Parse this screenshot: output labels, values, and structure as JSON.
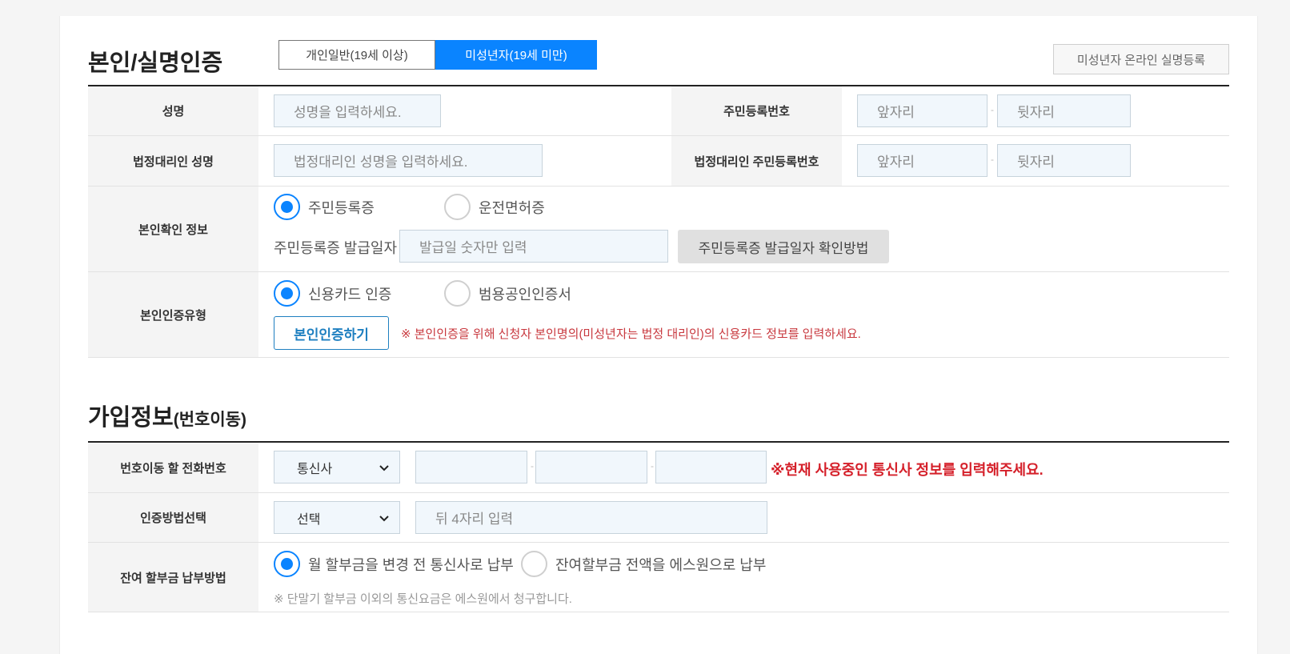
{
  "section1": {
    "title": "본인/실명인증",
    "tabs": [
      {
        "label": "개인일반(19세 이상)",
        "active": false
      },
      {
        "label": "미성년자(19세 미만)",
        "active": true
      }
    ],
    "register_button": "미성년자 온라인 실명등록",
    "rows": {
      "name": {
        "label": "성명",
        "placeholder": "성명을 입력하세요."
      },
      "rrn": {
        "label": "주민등록번호",
        "front_placeholder": "앞자리",
        "back_placeholder": "뒷자리"
      },
      "guardian_name": {
        "label": "법정대리인 성명",
        "placeholder": "법정대리인 성명을 입력하세요."
      },
      "guardian_rrn": {
        "label": "법정대리인 주민등록번호",
        "front_placeholder": "앞자리",
        "back_placeholder": "뒷자리"
      },
      "id_info": {
        "label": "본인확인 정보",
        "options": [
          {
            "label": "주민등록증",
            "checked": true
          },
          {
            "label": "운전면허증",
            "checked": false
          }
        ],
        "issue_date_label": "주민등록증 발급일자",
        "issue_date_placeholder": "발급일 숫자만 입력",
        "how_to_button": "주민등록증 발급일자 확인방법"
      },
      "auth_type": {
        "label": "본인인증유형",
        "options": [
          {
            "label": "신용카드 인증",
            "checked": true
          },
          {
            "label": "범용공인인증서",
            "checked": false
          }
        ],
        "auth_button": "본인인증하기",
        "notice": "※ 본인인증을 위해 신청자 본인명의(미성년자는 법정 대리인)의 신용카드 정보를 입력하세요."
      }
    }
  },
  "section2": {
    "title": "가입정보",
    "title_sub": "(번호이동)",
    "rows": {
      "phone": {
        "label": "번호이동 할 전화번호",
        "carrier_select": "통신사",
        "notice": "※현재 사용중인 통신사 정보를 입력해주세요."
      },
      "auth_method": {
        "label": "인증방법선택",
        "select": "선택",
        "placeholder": "뒤 4자리 입력"
      },
      "installment": {
        "label": "잔여 할부금 납부방법",
        "options": [
          {
            "label": "월 할부금을 변경 전 통신사로 납부",
            "checked": true
          },
          {
            "label": "잔여할부금 전액을 에스원으로 납부",
            "checked": false
          }
        ],
        "notice": "※ 단말기 할부금 이외의 통신요금은 에스원에서 청구합니다."
      }
    }
  },
  "colors": {
    "accent": "#0a84ff",
    "notice_red": "#d5202a",
    "input_bg": "#f1f7fc"
  },
  "icons": {
    "select_chevron": "chevron-down-icon"
  }
}
